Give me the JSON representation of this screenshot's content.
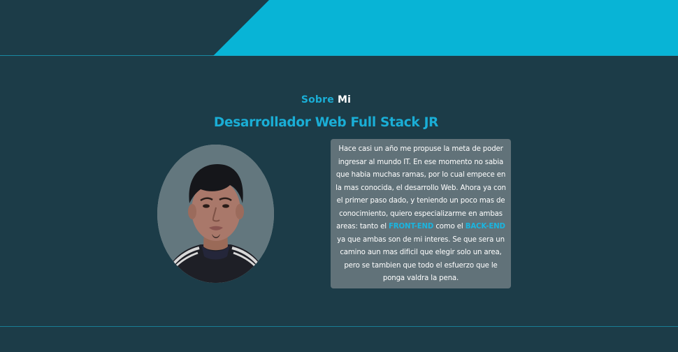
{
  "header": {
    "accent_color": "#08b4d6",
    "background_color": "#1c3c48"
  },
  "about": {
    "kicker_primary": "Sobre",
    "kicker_secondary": "Mi",
    "title": "Desarrollador Web Full Stack JR",
    "description_part1": "Hace casi un año me propuse la meta de poder ingresar al mundo IT. En ese momento no sabia que habia muchas ramas, por lo cual empece en la mas conocida, el desarrollo Web. Ahora ya con el primer paso dado, y teniendo un poco mas de conocimiento, quiero especializarme en ambas areas: tanto el ",
    "highlight_front": "FRONT-END",
    "description_part2": " como el ",
    "highlight_back": "BACK-END",
    "description_part3": " ya que ambas son de mi interes. Se que sera un camino aun mas dificil que elegir solo un area, pero se tambien que todo el esfuerzo que le ponga valdra la pena."
  },
  "colors": {
    "accent": "#1aaed6",
    "card": "#617279",
    "background": "#1c3c48"
  }
}
